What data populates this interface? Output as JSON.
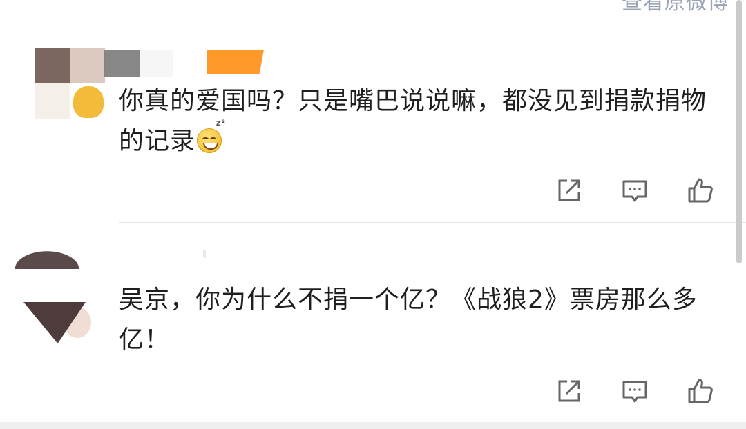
{
  "top_link": {
    "text": "查看原微博"
  },
  "comments": [
    {
      "text": "你真的爱国吗？只是嘴巴说说嘛，都没见到捐款捐物的记录",
      "emoji": "sleepy-smile-emoji",
      "actions": [
        "share-icon",
        "reply-icon",
        "like-icon"
      ]
    },
    {
      "text": "吴京，你为什么不捐一个亿？《战狼2》票房那么多亿！",
      "actions": [
        "share-icon",
        "reply-icon",
        "like-icon"
      ]
    }
  ],
  "colors": {
    "text": "#1f1f1f",
    "icon": "#666666",
    "divider": "#e6e6e6",
    "link": "#9aa3b5"
  }
}
